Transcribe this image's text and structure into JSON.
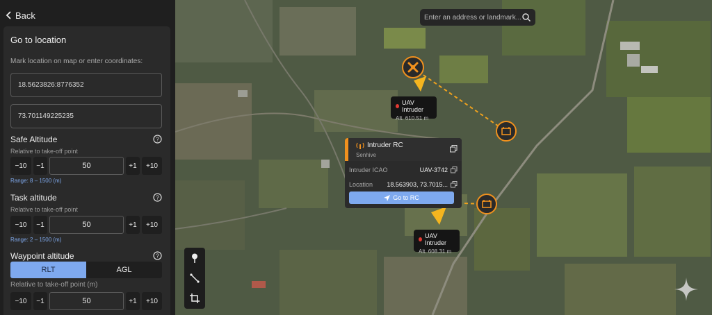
{
  "nav": {
    "back_label": "Back"
  },
  "panel": {
    "title": "Go to location",
    "hint": "Mark location on map or enter coordinates:",
    "latitude_value": "18.5623826:8776352",
    "longitude_value": "73.701149225235",
    "safe_altitude": {
      "title": "Safe Altitude",
      "subtitle": "Relative to take-off point",
      "minus10": "−10",
      "minus1": "−1",
      "value": "50",
      "plus1": "+1",
      "plus10": "+10",
      "range": "Range: 8 – 1500 (m)"
    },
    "task_altitude": {
      "title": "Task altitude",
      "subtitle": "Relative to take-off point",
      "minus10": "−10",
      "minus1": "−1",
      "value": "50",
      "plus1": "+1",
      "plus10": "+10",
      "range": "Range: 2 – 1500 (m)"
    },
    "waypoint_altitude": {
      "title": "Waypoint altitude",
      "mode_rlt": "RLT",
      "mode_agl": "AGL",
      "selected": "RLT",
      "subtitle": "Relative to take-off point (m)",
      "minus10": "−10",
      "minus1": "−1",
      "value": "50",
      "plus1": "+1",
      "plus10": "+10"
    }
  },
  "map": {
    "search_placeholder": "Enter an address or landmark...",
    "uav_top": {
      "name": "UAV Intruder",
      "altitude": "Alt. 610.51 m"
    },
    "uav_bottom": {
      "name": "UAV Intruder",
      "altitude": "Alt. 608.31 m"
    },
    "popup": {
      "title": "Intruder RC",
      "subtitle": "Senhive",
      "icao_label": "Intruder ICAO",
      "icao_value": "UAV-3742",
      "location_label": "Location",
      "location_value": "18.563903, 73.7015...",
      "button_label": "Go to RC"
    }
  },
  "colors": {
    "accent_orange": "#f0911e",
    "accent_blue": "#7ea9ef",
    "alert_red": "#e33a33",
    "panel_bg": "#2a2a2a"
  },
  "icons": [
    "chevron-left-icon",
    "search-icon",
    "drone-icon",
    "dock-icon",
    "rc-antenna-icon",
    "copy-icon",
    "navigation-arrow-icon",
    "info-icon",
    "pin-tool-icon",
    "line-tool-icon",
    "crop-tool-icon",
    "sparkle-icon"
  ]
}
